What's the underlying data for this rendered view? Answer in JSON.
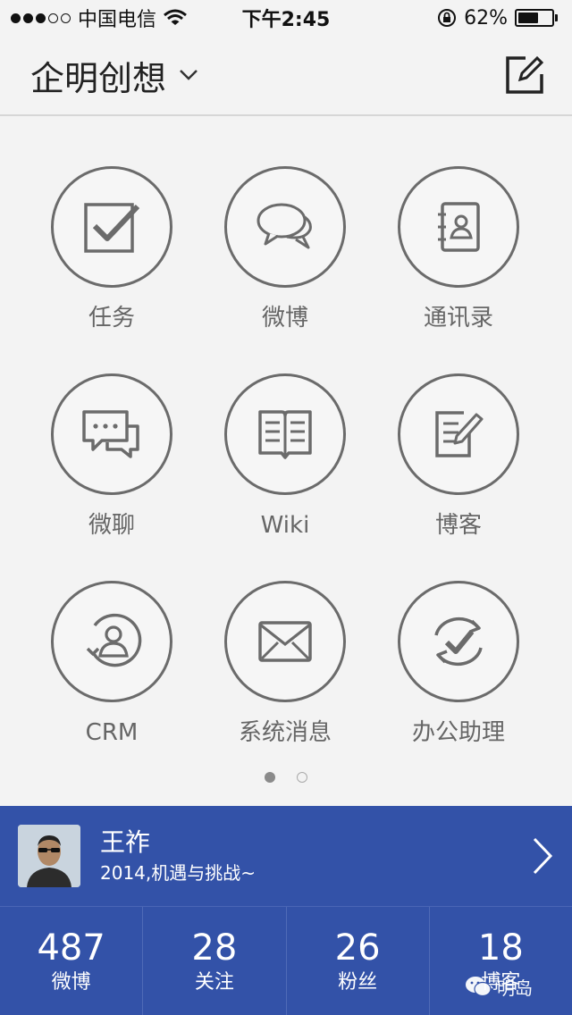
{
  "status_bar": {
    "carrier": "中国电信",
    "time": "下午2:45",
    "battery": "62%",
    "battery_level": 0.62
  },
  "header": {
    "title": "企明创想",
    "dropdown_icon": "chevron-down-icon",
    "compose_icon": "compose-icon"
  },
  "apps": [
    {
      "label": "任务",
      "icon": "checkbox-icon"
    },
    {
      "label": "微博",
      "icon": "speech-bubbles-icon"
    },
    {
      "label": "通讯录",
      "icon": "address-book-icon"
    },
    {
      "label": "微聊",
      "icon": "chat-icon"
    },
    {
      "label": "Wiki",
      "icon": "book-icon"
    },
    {
      "label": "博客",
      "icon": "edit-note-icon"
    },
    {
      "label": "CRM",
      "icon": "crm-icon"
    },
    {
      "label": "系统消息",
      "icon": "envelope-icon"
    },
    {
      "label": "办公助理",
      "icon": "assistant-check-icon"
    }
  ],
  "pager": {
    "current": 1,
    "total": 2
  },
  "profile": {
    "name": "王祚",
    "motto": "2014,机遇与挑战~"
  },
  "stats": [
    {
      "value": "487",
      "label": "微博"
    },
    {
      "value": "28",
      "label": "关注"
    },
    {
      "value": "26",
      "label": "粉丝"
    },
    {
      "value": "18",
      "label": "博客"
    }
  ],
  "watermark": {
    "text": "明岛"
  },
  "colors": {
    "accent": "#3352a8",
    "background": "#f3f3f3",
    "icon_stroke": "#6b6b6b"
  }
}
